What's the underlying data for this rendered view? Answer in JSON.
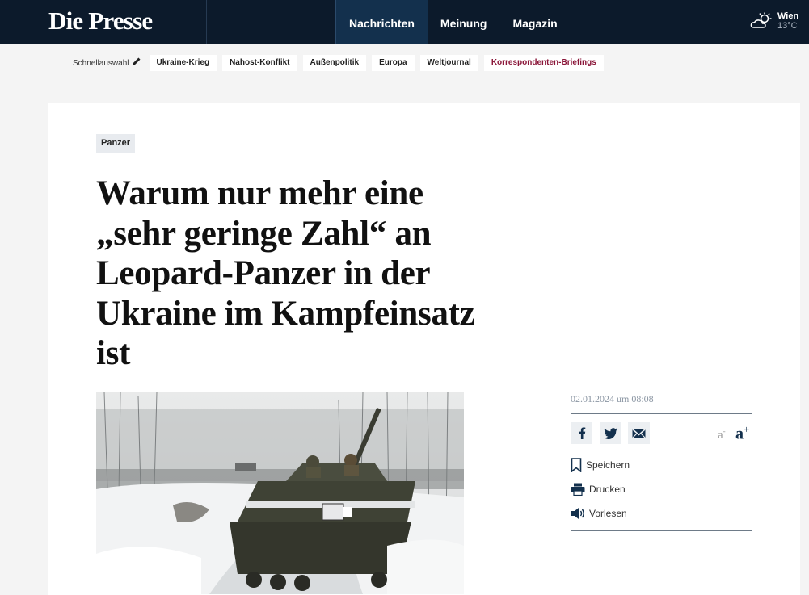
{
  "header": {
    "logo": "Die Presse",
    "nav": [
      "Nachrichten",
      "Meinung",
      "Magazin"
    ],
    "weather": {
      "city": "Wien",
      "temp": "13°C",
      "icon": "cloud-sun-icon"
    }
  },
  "quickbar": {
    "label": "Schnellauswahl",
    "items": [
      "Ukraine-Krieg",
      "Nahost-Konflikt",
      "Außenpolitik",
      "Europa",
      "Weltjournal",
      "Korrespondenten-Briefings"
    ]
  },
  "article": {
    "tag": "Panzer",
    "headline": "Warum nur mehr eine „sehr geringe Zahl“ an Leopard-Panzer in der Ukraine im Kampfeinsatz ist",
    "date": "02.01.2024 um 08:08"
  },
  "tools": {
    "font_small": "a",
    "font_small_mark": "-",
    "font_large": "a",
    "font_large_mark": "+",
    "save": "Speichern",
    "print": "Drucken",
    "read": "Vorlesen"
  },
  "colors": {
    "nav_bg": "#0c1a2b",
    "accent_red": "#8a1538"
  }
}
